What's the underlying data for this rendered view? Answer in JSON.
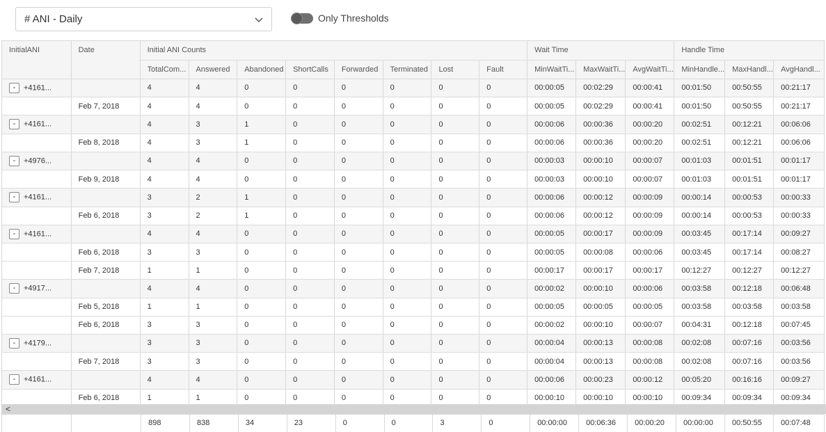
{
  "toolbar": {
    "report_select": "# ANI - Daily",
    "toggle_label": "Only Thresholds",
    "toggle_on": false
  },
  "grid": {
    "group_headers": [
      {
        "label": "InitialANI"
      },
      {
        "label": "Date"
      },
      {
        "label": "Initial ANI Counts"
      },
      {
        "label": "Wait Time"
      },
      {
        "label": "Handle Time"
      }
    ],
    "columns": [
      "TotalCom...",
      "Answered",
      "Abandoned",
      "ShortCalls",
      "Forwarded",
      "Terminated",
      "Lost",
      "Fault",
      "MinWaitTi...",
      "MaxWaitTi...",
      "AvgWaitTi...",
      "MinHandle...",
      "MaxHandl...",
      "AvgHandl..."
    ],
    "rows": [
      {
        "type": "group",
        "ani": "+4161...",
        "date": "",
        "values": [
          "4",
          "4",
          "0",
          "0",
          "0",
          "0",
          "0",
          "0",
          "00:00:05",
          "00:02:29",
          "00:00:41",
          "00:01:50",
          "00:50:55",
          "00:21:17"
        ]
      },
      {
        "type": "detail",
        "ani": "",
        "date": "Feb 7, 2018",
        "values": [
          "4",
          "4",
          "0",
          "0",
          "0",
          "0",
          "0",
          "0",
          "00:00:05",
          "00:02:29",
          "00:00:41",
          "00:01:50",
          "00:50:55",
          "00:21:17"
        ]
      },
      {
        "type": "group",
        "ani": "+4161...",
        "date": "",
        "values": [
          "4",
          "3",
          "1",
          "0",
          "0",
          "0",
          "0",
          "0",
          "00:00:06",
          "00:00:36",
          "00:00:20",
          "00:02:51",
          "00:12:21",
          "00:06:06"
        ]
      },
      {
        "type": "detail",
        "ani": "",
        "date": "Feb 8, 2018",
        "values": [
          "4",
          "3",
          "1",
          "0",
          "0",
          "0",
          "0",
          "0",
          "00:00:06",
          "00:00:36",
          "00:00:20",
          "00:02:51",
          "00:12:21",
          "00:06:06"
        ]
      },
      {
        "type": "group",
        "ani": "+4976...",
        "date": "",
        "values": [
          "4",
          "4",
          "0",
          "0",
          "0",
          "0",
          "0",
          "0",
          "00:00:03",
          "00:00:10",
          "00:00:07",
          "00:01:03",
          "00:01:51",
          "00:01:17"
        ]
      },
      {
        "type": "detail",
        "ani": "",
        "date": "Feb 9, 2018",
        "values": [
          "4",
          "4",
          "0",
          "0",
          "0",
          "0",
          "0",
          "0",
          "00:00:03",
          "00:00:10",
          "00:00:07",
          "00:01:03",
          "00:01:51",
          "00:01:17"
        ]
      },
      {
        "type": "group",
        "ani": "+4161...",
        "date": "",
        "values": [
          "3",
          "2",
          "1",
          "0",
          "0",
          "0",
          "0",
          "0",
          "00:00:06",
          "00:00:12",
          "00:00:09",
          "00:00:14",
          "00:00:53",
          "00:00:33"
        ]
      },
      {
        "type": "detail",
        "ani": "",
        "date": "Feb 6, 2018",
        "values": [
          "3",
          "2",
          "1",
          "0",
          "0",
          "0",
          "0",
          "0",
          "00:00:06",
          "00:00:12",
          "00:00:09",
          "00:00:14",
          "00:00:53",
          "00:00:33"
        ]
      },
      {
        "type": "group",
        "ani": "+4161...",
        "date": "",
        "values": [
          "4",
          "4",
          "0",
          "0",
          "0",
          "0",
          "0",
          "0",
          "00:00:05",
          "00:00:17",
          "00:00:09",
          "00:03:45",
          "00:17:14",
          "00:09:27"
        ]
      },
      {
        "type": "detail",
        "ani": "",
        "date": "Feb 6, 2018",
        "values": [
          "3",
          "3",
          "0",
          "0",
          "0",
          "0",
          "0",
          "0",
          "00:00:05",
          "00:00:08",
          "00:00:06",
          "00:03:45",
          "00:17:14",
          "00:08:27"
        ]
      },
      {
        "type": "detail",
        "ani": "",
        "date": "Feb 7, 2018",
        "values": [
          "1",
          "1",
          "0",
          "0",
          "0",
          "0",
          "0",
          "0",
          "00:00:17",
          "00:00:17",
          "00:00:17",
          "00:12:27",
          "00:12:27",
          "00:12:27"
        ]
      },
      {
        "type": "group",
        "ani": "+4917...",
        "date": "",
        "values": [
          "4",
          "4",
          "0",
          "0",
          "0",
          "0",
          "0",
          "0",
          "00:00:02",
          "00:00:10",
          "00:00:06",
          "00:03:58",
          "00:12:18",
          "00:06:48"
        ]
      },
      {
        "type": "detail",
        "ani": "",
        "date": "Feb 5, 2018",
        "values": [
          "1",
          "1",
          "0",
          "0",
          "0",
          "0",
          "0",
          "0",
          "00:00:05",
          "00:00:05",
          "00:00:05",
          "00:03:58",
          "00:03:58",
          "00:03:58"
        ]
      },
      {
        "type": "detail",
        "ani": "",
        "date": "Feb 6, 2018",
        "values": [
          "3",
          "3",
          "0",
          "0",
          "0",
          "0",
          "0",
          "0",
          "00:00:02",
          "00:00:10",
          "00:00:07",
          "00:04:31",
          "00:12:18",
          "00:07:45"
        ]
      },
      {
        "type": "group",
        "ani": "+4179...",
        "date": "",
        "values": [
          "3",
          "3",
          "0",
          "0",
          "0",
          "0",
          "0",
          "0",
          "00:00:04",
          "00:00:13",
          "00:00:08",
          "00:02:08",
          "00:07:16",
          "00:03:56"
        ]
      },
      {
        "type": "detail",
        "ani": "",
        "date": "Feb 7, 2018",
        "values": [
          "3",
          "3",
          "0",
          "0",
          "0",
          "0",
          "0",
          "0",
          "00:00:04",
          "00:00:13",
          "00:00:08",
          "00:02:08",
          "00:07:16",
          "00:03:56"
        ]
      },
      {
        "type": "group",
        "ani": "+4161...",
        "date": "",
        "values": [
          "4",
          "4",
          "0",
          "0",
          "0",
          "0",
          "0",
          "0",
          "00:00:06",
          "00:00:23",
          "00:00:12",
          "00:05:20",
          "00:16:16",
          "00:09:27"
        ]
      },
      {
        "type": "detail",
        "ani": "",
        "date": "Feb 6, 2018",
        "values": [
          "1",
          "1",
          "0",
          "0",
          "0",
          "0",
          "0",
          "0",
          "00:00:10",
          "00:00:10",
          "00:00:10",
          "00:09:34",
          "00:09:34",
          "00:09:34"
        ]
      }
    ],
    "expander_symbol": "-",
    "totals": [
      "898",
      "838",
      "34",
      "23",
      "0",
      "0",
      "3",
      "0",
      "00:00:00",
      "00:06:36",
      "00:00:20",
      "00:00:00",
      "00:50:55",
      "00:07:48"
    ]
  },
  "scrollbar": {
    "left_arrow": "<"
  }
}
